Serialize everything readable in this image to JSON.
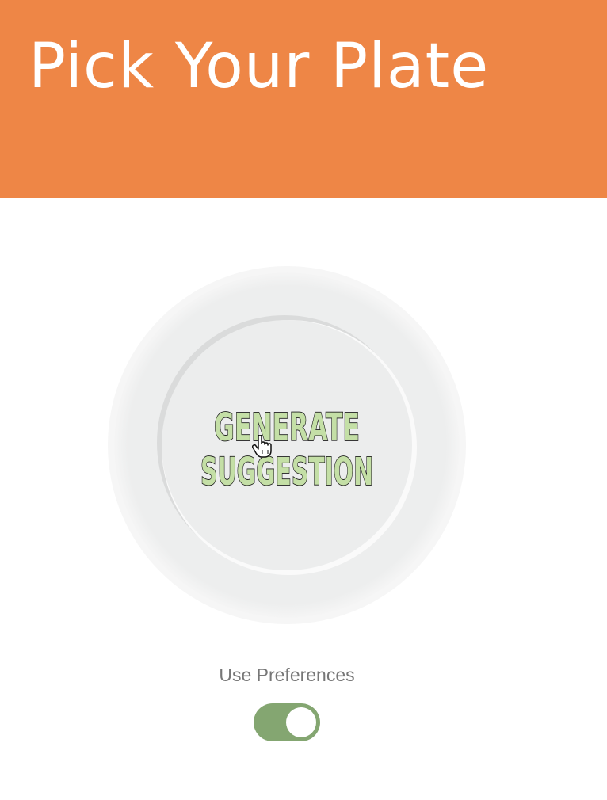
{
  "header": {
    "title": "Pick Your Plate",
    "background": "#EE8646"
  },
  "plate": {
    "button_line1": "GENERATE",
    "button_line2": "SUGGESTION",
    "text_fill": "#C4DFA6",
    "text_outline": "#1A1A1A",
    "cursor_icon": "hand-pointer-icon"
  },
  "preferences": {
    "label": "Use Preferences",
    "toggle_on": true,
    "toggle_color": "#84A671"
  }
}
